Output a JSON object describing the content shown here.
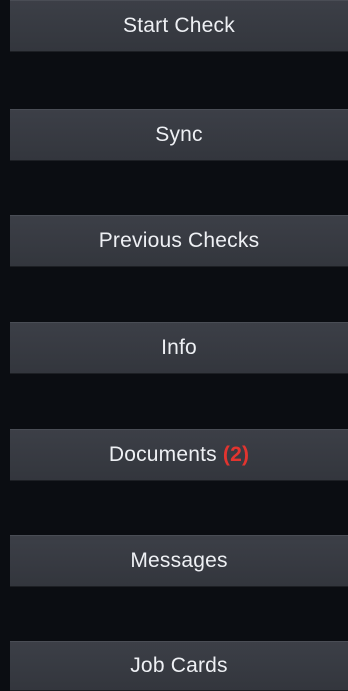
{
  "theme": {
    "background": "#0b0d12",
    "button_background": "#383b42",
    "button_text": "#eef0f4",
    "badge_color": "#e2342f"
  },
  "menu": {
    "start_check": {
      "label": "Start Check"
    },
    "sync": {
      "label": "Sync"
    },
    "previous_checks": {
      "label": "Previous Checks"
    },
    "info": {
      "label": "Info"
    },
    "documents": {
      "label": "Documents",
      "badge": "(2)"
    },
    "messages": {
      "label": "Messages"
    },
    "job_cards": {
      "label": "Job Cards"
    }
  }
}
